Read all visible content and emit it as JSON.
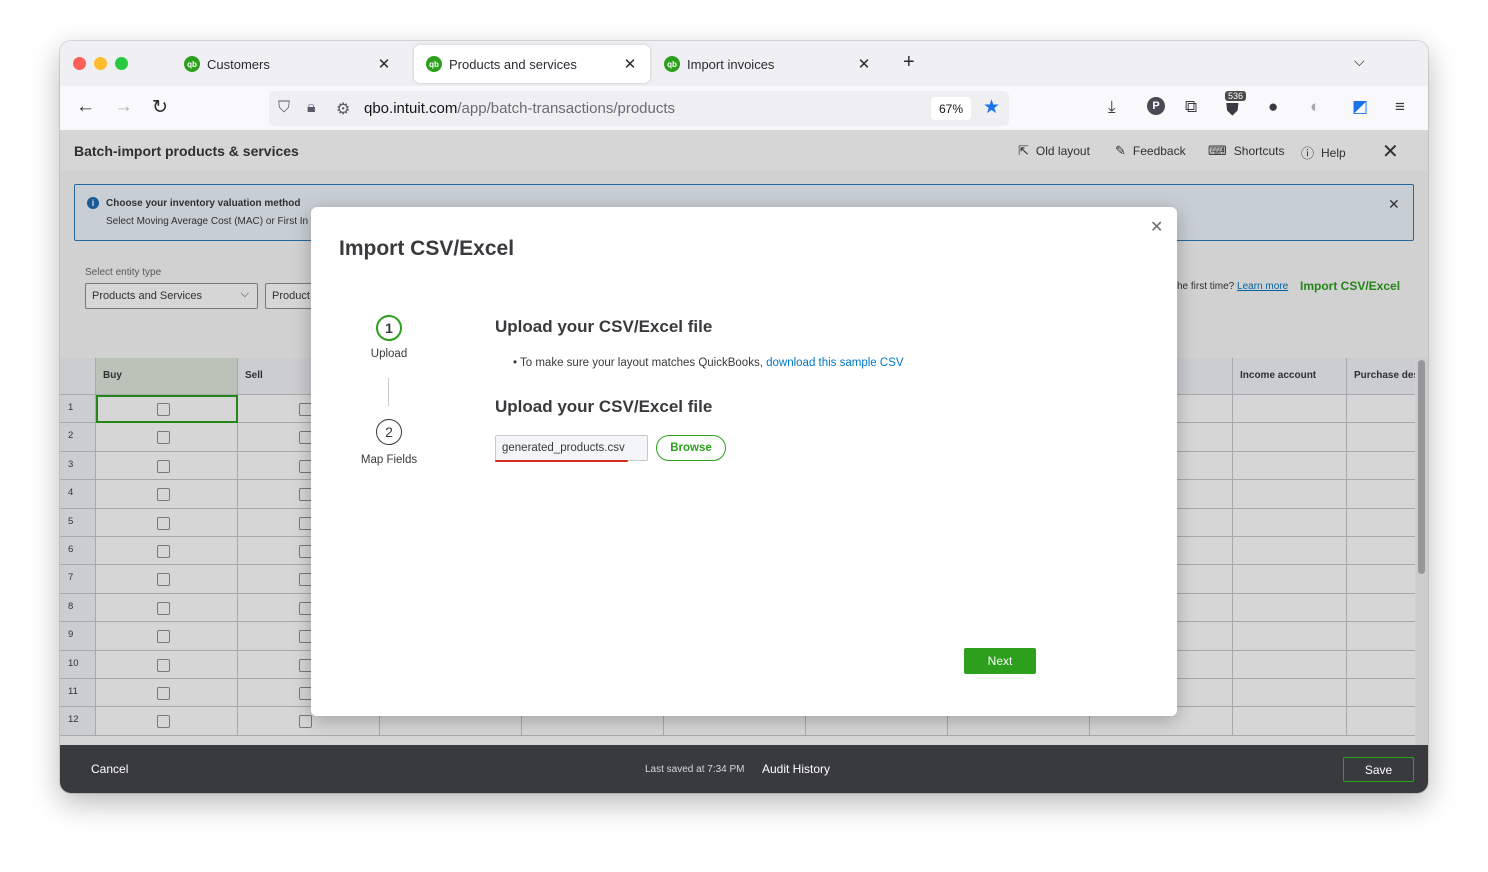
{
  "browser": {
    "tabs": [
      {
        "title": "Customers",
        "favicon": "qb"
      },
      {
        "title": "Products and services",
        "favicon": "qb",
        "active": true
      },
      {
        "title": "Import invoices",
        "favicon": "qb"
      }
    ],
    "url_domain": "qbo.intuit.com",
    "url_path": "/app/batch-transactions/products",
    "zoom": "67%",
    "badge_count": "536",
    "profile_initial": "P"
  },
  "app": {
    "title": "Batch-import products & services",
    "header_actions": {
      "old_layout": "Old layout",
      "feedback": "Feedback",
      "shortcuts": "Shortcuts",
      "help": "Help"
    },
    "banner": {
      "title": "Choose your inventory valuation method",
      "text": "Select Moving Average Cost (MAC) or First In"
    },
    "filters": {
      "entity_label": "Select entity type",
      "entity_value": "Products and Services",
      "second_value": "Product"
    },
    "first_time_text": "he first time?",
    "learn_more": "Learn more",
    "import_link": "Import CSV/Excel"
  },
  "grid": {
    "columns": [
      "Buy",
      "Sell",
      "Income account",
      "Purchase des"
    ],
    "rows": [
      "1",
      "2",
      "3",
      "4",
      "5",
      "6",
      "7",
      "8",
      "9",
      "10",
      "11",
      "12"
    ]
  },
  "footer": {
    "cancel": "Cancel",
    "last_saved": "Last saved at 7:34 PM",
    "audit_history": "Audit History",
    "save": "Save"
  },
  "modal": {
    "title": "Import CSV/Excel",
    "steps": [
      {
        "number": "1",
        "label": "Upload"
      },
      {
        "number": "2",
        "label": "Map Fields"
      }
    ],
    "section_title": "Upload your CSV/Excel file",
    "bullet_text": "To make sure your layout matches QuickBooks,",
    "bullet_link": "download this sample CSV",
    "upload_title": "Upload your CSV/Excel file",
    "file_name": "generated_products.csv",
    "browse": "Browse",
    "next": "Next"
  },
  "colors": {
    "brand_green": "#2ca01c",
    "link_blue": "#0077c5",
    "footer_bg": "#393a3d",
    "annotation_red": "#d52b1e"
  }
}
